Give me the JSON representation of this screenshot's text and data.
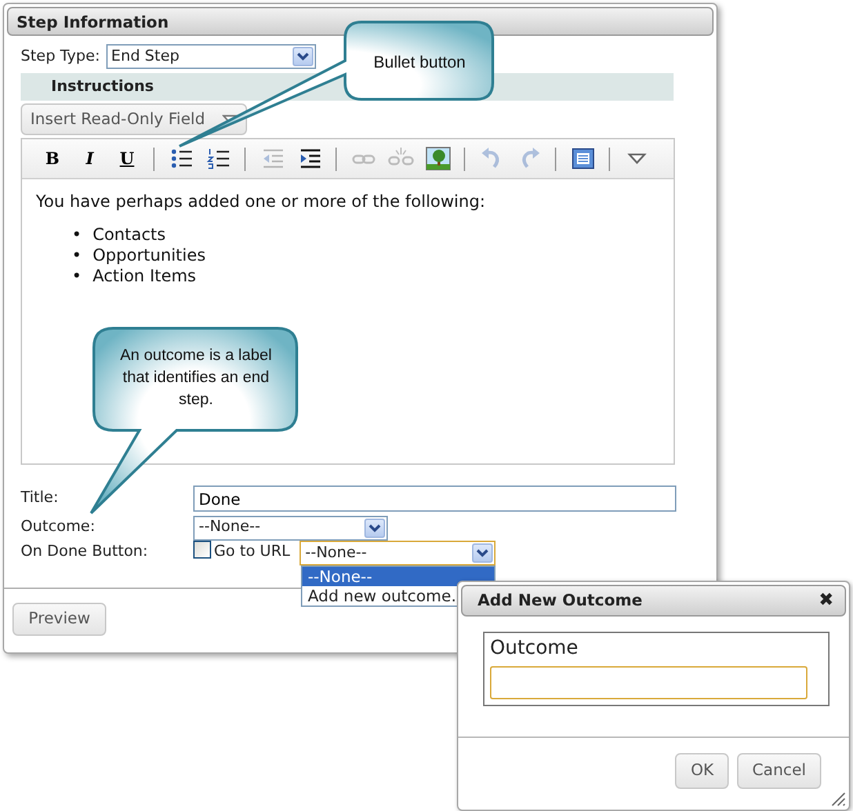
{
  "panel": {
    "title": "Step Information"
  },
  "step_type": {
    "label": "Step Type:",
    "value": "End Step"
  },
  "instructions": {
    "heading": "Instructions",
    "insert_button": "Insert Read-Only Field"
  },
  "toolbar": [
    {
      "kind": "bold",
      "label": "B",
      "disabled": false
    },
    {
      "kind": "italic",
      "label": "I",
      "disabled": false
    },
    {
      "kind": "underline",
      "label": "U",
      "disabled": false
    },
    {
      "kind": "separator"
    },
    {
      "kind": "bullets",
      "disabled": false
    },
    {
      "kind": "numbering",
      "disabled": false
    },
    {
      "kind": "separator"
    },
    {
      "kind": "outdent",
      "disabled": true
    },
    {
      "kind": "indent",
      "disabled": false
    },
    {
      "kind": "separator"
    },
    {
      "kind": "link",
      "disabled": true
    },
    {
      "kind": "unlink",
      "disabled": true
    },
    {
      "kind": "image",
      "disabled": false
    },
    {
      "kind": "separator"
    },
    {
      "kind": "undo",
      "disabled": true
    },
    {
      "kind": "redo",
      "disabled": true
    },
    {
      "kind": "separator"
    },
    {
      "kind": "source",
      "disabled": false
    },
    {
      "kind": "separator"
    },
    {
      "kind": "more",
      "disabled": false
    }
  ],
  "editor": {
    "text": "You have perhaps added one or more of the following:",
    "bullets": [
      {
        "marker": "•",
        "text": "Contacts"
      },
      {
        "marker": "•",
        "text": "Opportunities"
      },
      {
        "marker": "•",
        "text": "Action Items"
      }
    ]
  },
  "fields": {
    "title": {
      "label": "Title:",
      "value": "Done"
    },
    "outcome": {
      "label": "Outcome:",
      "value": "--None--"
    },
    "on_done": {
      "label": "On Done Button:",
      "checkbox_label": "Go to URL",
      "checked": false,
      "value": "--None--",
      "options": [
        {
          "label": "--None--",
          "selected": true
        },
        {
          "label": "Add new outcome.",
          "selected": false
        }
      ]
    }
  },
  "preview_button": "Preview",
  "dialog": {
    "title": "Add New Outcome",
    "close": "✖",
    "field_label": "Outcome",
    "buttons": [
      "OK",
      "Cancel"
    ]
  },
  "callouts": [
    {
      "text": "Bullet button"
    },
    {
      "text": "An outcome is a label that identifies an end step."
    }
  ]
}
